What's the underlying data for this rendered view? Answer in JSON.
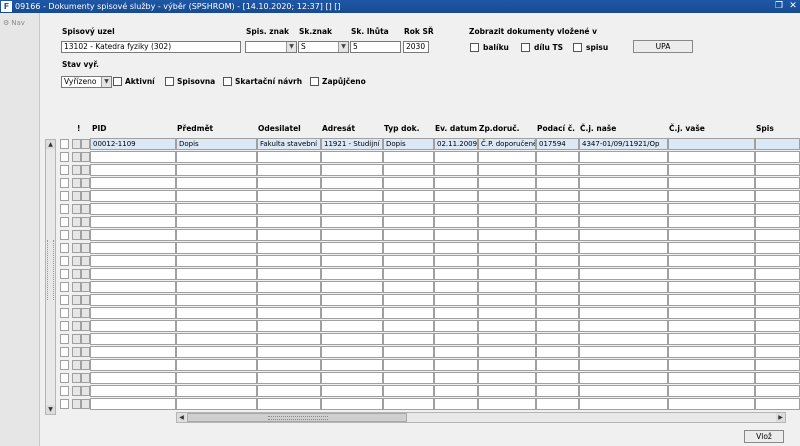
{
  "window": {
    "app_icon": "oracle-forms-icon",
    "title": "09166 - Dokumenty spisové služby - výběr (SPSHROM) - [14.10.2020; 12:37] [] []",
    "restore_icon": "restore-window-icon",
    "close_icon": "close-window-icon"
  },
  "leftbar": {
    "nav_label": "Nav",
    "nav_icon": "gear-icon"
  },
  "form": {
    "spisovy_uzel_label": "Spisový uzel",
    "spisovy_uzel_value": "13102 - Katedra  fyziky (302)",
    "spis_znak_label": "Spis. znak",
    "spis_znak_value": "",
    "sk_znak_label": "Sk.znak",
    "sk_znak_value": "S",
    "sk_lhuta_label": "Sk. lhůta",
    "sk_lhuta_value": "5",
    "rok_sr_label": "Rok SŘ",
    "rok_sr_value": "2030",
    "zobrazit_label": "Zobrazit dokumenty vložené v",
    "balik_label": "balíku",
    "dilu_ts_label": "dílu TS",
    "spisu_label": "spisu",
    "upa_button": "UPA",
    "stav_label": "Stav vyř.",
    "stav_value": "Vyřízeno",
    "aktivni_label": "Aktivní",
    "spisovna_label": "Spisovna",
    "skartacni_label": "Skartační návrh",
    "zapujceno_label": "Zapůjčeno"
  },
  "grid": {
    "headers": {
      "excl": "!",
      "pid": "PID",
      "predmet": "Předmět",
      "odesilatel": "Odesilatel",
      "adresat": "Adresát",
      "typ": "Typ dok.",
      "ev_datum": "Ev. datum",
      "zp_doruc": "Zp.doruč.",
      "podaci": "Podací č.",
      "cj_nase": "Č.j. naše",
      "cj_vase": "Č.j. vaše",
      "spis": "Spis"
    },
    "rows": [
      {
        "pid": "00012-1109",
        "predmet": "Dopis",
        "odesilatel": "Fakulta stavební",
        "adresat": "11921 - Studijní oc",
        "typ": "Dopis",
        "ev_datum": "02.11.2009",
        "zp_doruc": "Č.P. doporučeně",
        "podaci": "017594",
        "cj_nase": "4347-01/09/11921/Op",
        "cj_vase": "",
        "spis": ""
      }
    ],
    "empty_row_count": 20
  },
  "footer": {
    "vloz_button": "Vlož"
  }
}
